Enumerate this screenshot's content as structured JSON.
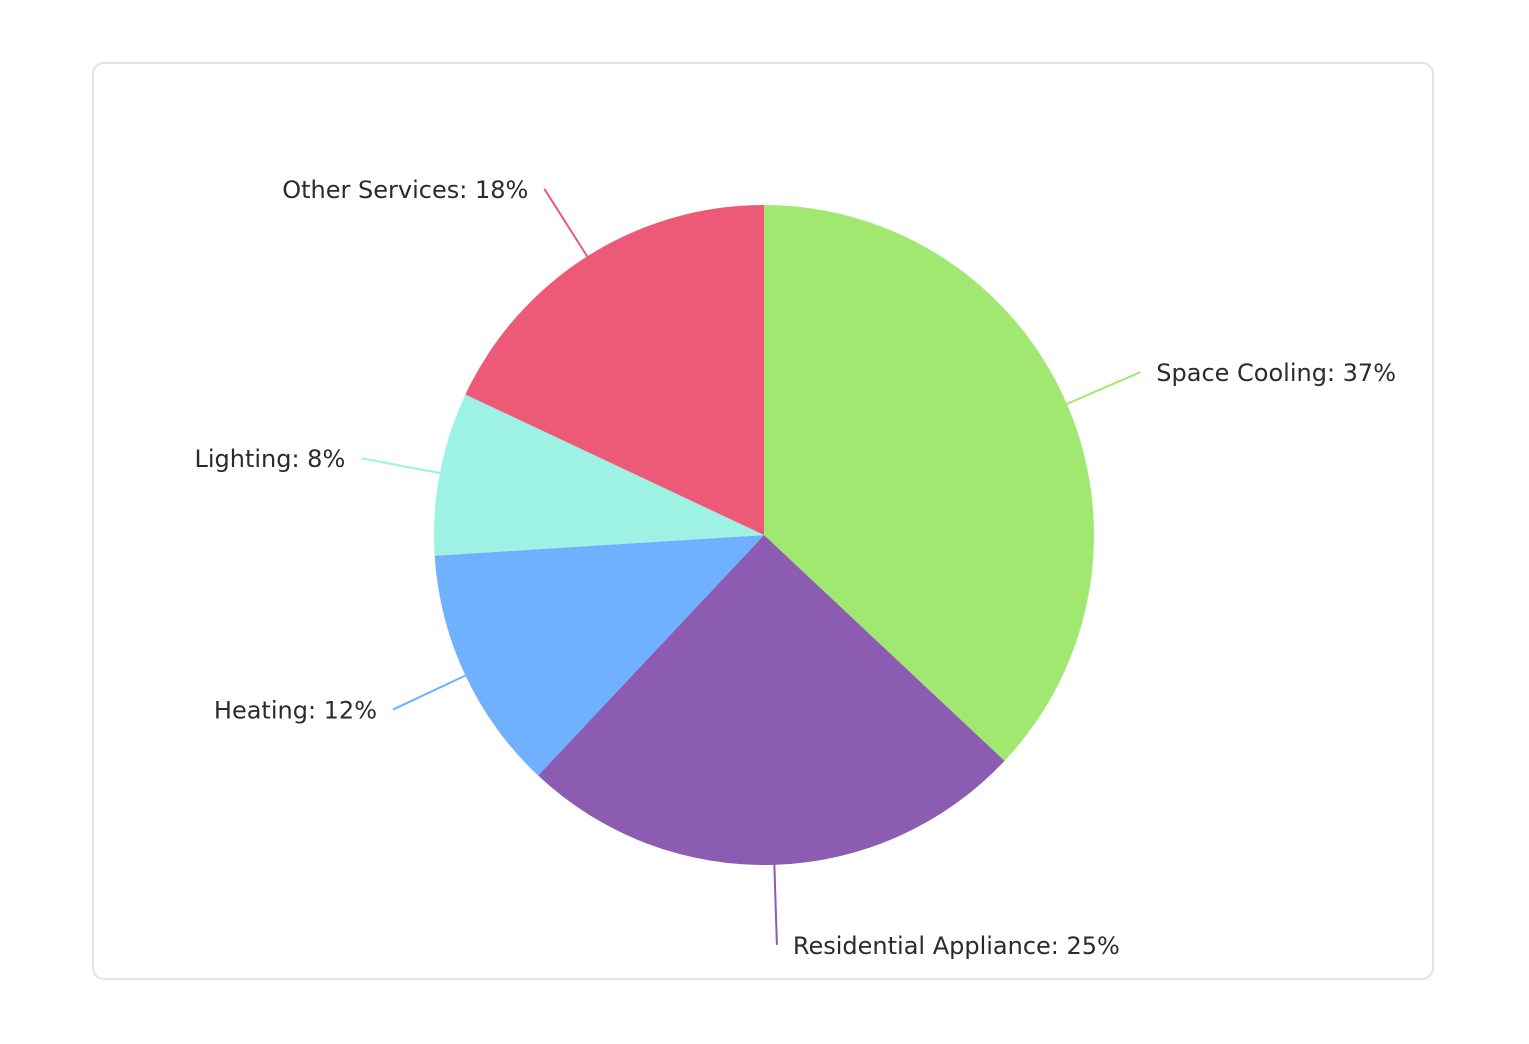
{
  "chart_data": {
    "type": "pie",
    "title": "",
    "start_angle_deg": 0,
    "direction": "clockwise",
    "slices": [
      {
        "name": "Space Cooling",
        "value": 37,
        "label": "Space Cooling: 37%",
        "color": "#a0e870"
      },
      {
        "name": "Residential Appliance",
        "value": 25,
        "label": "Residential Appliance: 25%",
        "color": "#8b5cb1"
      },
      {
        "name": "Heating",
        "value": 12,
        "label": "Heating: 12%",
        "color": "#6fb1ff"
      },
      {
        "name": "Lighting",
        "value": 8,
        "label": "Lighting: 8%",
        "color": "#9df2e4"
      },
      {
        "name": "Other Services",
        "value": 18,
        "label": "Other Services: 18%",
        "color": "#ec5a78"
      }
    ],
    "legend": "none"
  }
}
